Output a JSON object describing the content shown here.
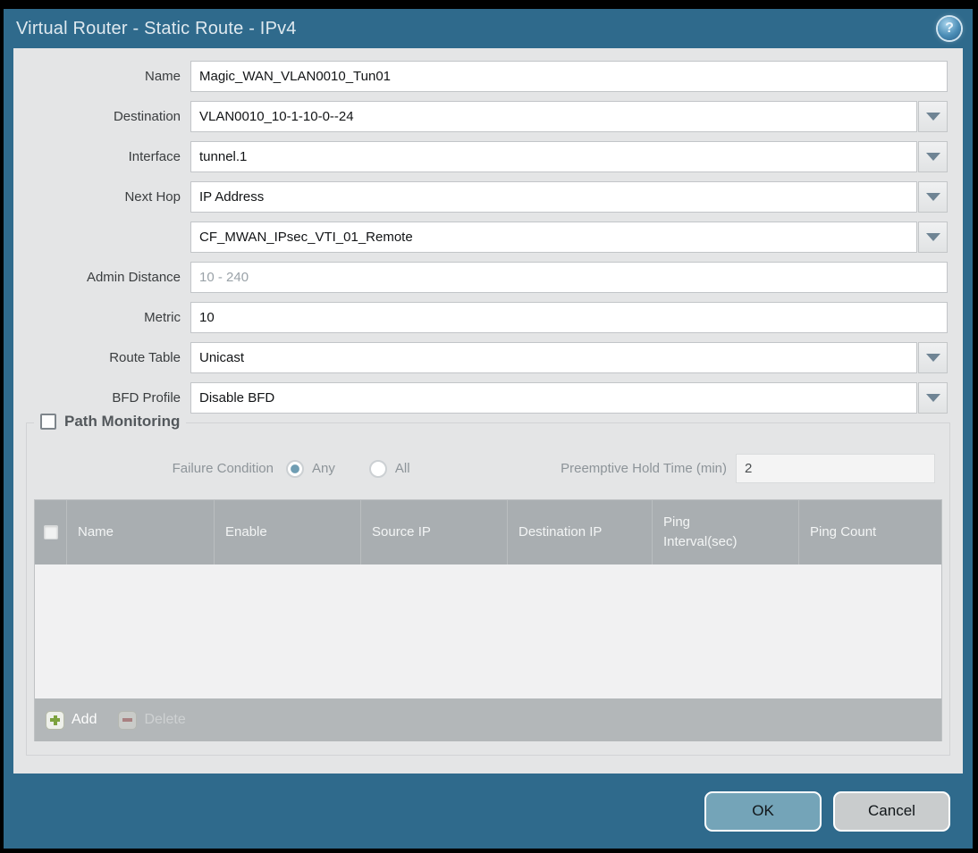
{
  "titlebar": {
    "title": "Virtual Router - Static Route - IPv4",
    "help_icon": "?"
  },
  "form": {
    "fields": [
      {
        "label": "Name",
        "value": "Magic_WAN_VLAN0010_Tun01",
        "type": "text"
      },
      {
        "label": "Destination",
        "value": "VLAN0010_10-1-10-0--24",
        "type": "dropdown"
      },
      {
        "label": "Interface",
        "value": "tunnel.1",
        "type": "dropdown"
      },
      {
        "label": "Next Hop",
        "value": "IP Address",
        "type": "dropdown"
      },
      {
        "label": "",
        "value": "CF_MWAN_IPsec_VTI_01_Remote",
        "type": "dropdown"
      },
      {
        "label": "Admin Distance",
        "value": "",
        "placeholder": "10 - 240",
        "type": "text"
      },
      {
        "label": "Metric",
        "value": "10",
        "type": "text"
      },
      {
        "label": "Route Table",
        "value": "Unicast",
        "type": "dropdown"
      },
      {
        "label": "BFD Profile",
        "value": "Disable BFD",
        "type": "dropdown"
      }
    ]
  },
  "path_monitoring": {
    "title": "Path Monitoring",
    "checkbox_checked": false,
    "failure_condition_label": "Failure Condition",
    "radio_any_label": "Any",
    "radio_all_label": "All",
    "selected_failure_condition": "Any",
    "preemptive_hold_label": "Preemptive Hold Time (min)",
    "preemptive_hold_value": "2",
    "table": {
      "columns": [
        "Name",
        "Enable",
        "Source IP",
        "Destination IP",
        "Ping Interval(sec)",
        "Ping Count"
      ],
      "rows": []
    },
    "add_label": "Add",
    "delete_label": "Delete",
    "delete_enabled": false
  },
  "footer": {
    "ok_label": "OK",
    "cancel_label": "Cancel"
  },
  "icons": [
    "help-icon",
    "chevron-down-icon",
    "add-icon",
    "delete-icon"
  ],
  "colors": {
    "frame_teal": "#2f6a8c",
    "content_gray": "#e4e5e6",
    "table_header_gray": "#a9aeb1",
    "table_footer_gray": "#b3b7b9",
    "ok_button_blue": "#74a4b8",
    "cancel_button_gray": "#c9cccd",
    "radio_selected_blue": "#6f9db3",
    "add_plus_green": "#7da23e",
    "delete_minus_red": "#a98181"
  }
}
